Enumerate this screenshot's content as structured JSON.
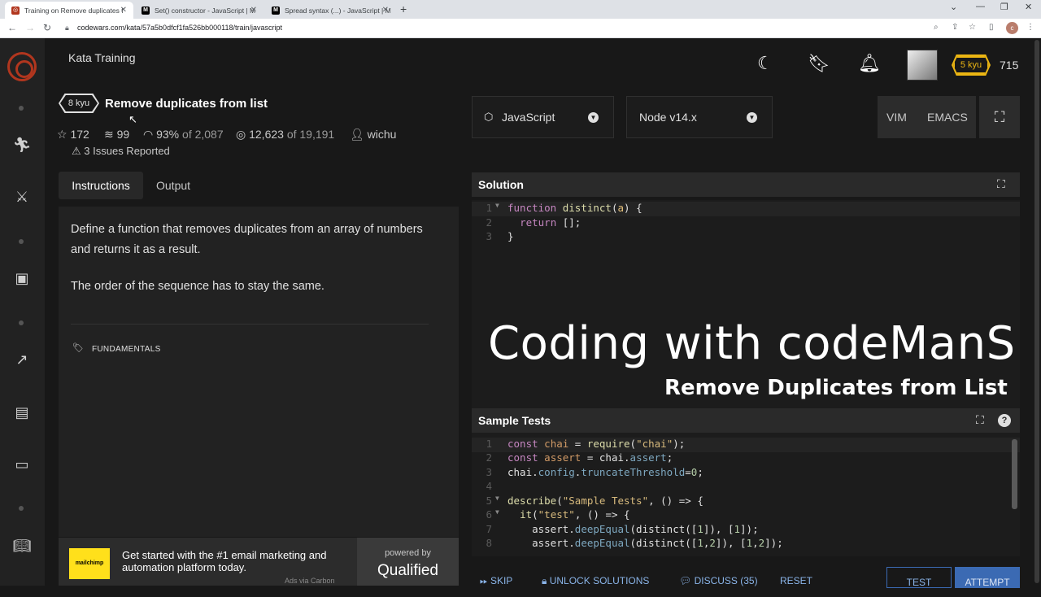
{
  "browser": {
    "tabs": [
      {
        "title": "Training on Remove duplicates f",
        "favicon_color": "#b1361e"
      },
      {
        "title": "Set() constructor - JavaScript | M",
        "favicon_color": "#000000"
      },
      {
        "title": "Spread syntax (...) - JavaScript | M",
        "favicon_color": "#000000"
      }
    ],
    "new_tab": "+",
    "url": "codewars.com/kata/57a5b0dfcf1fa526bb000118/train/javascript"
  },
  "app": {
    "header_title": "Kata Training",
    "rank": "5 kyu",
    "honor": "715"
  },
  "kata": {
    "kyu": "8 kyu",
    "title": "Remove duplicates from list",
    "stars": "172",
    "collections": "99",
    "satisfaction": "93%",
    "satisfaction_of": "of 2,087",
    "completed": "12,623",
    "completed_of": "of 19,191",
    "author": "wichu",
    "issues": "3 Issues Reported"
  },
  "tabs": {
    "instructions": "Instructions",
    "output": "Output"
  },
  "description": {
    "p1": "Define a function that removes duplicates from an array of numbers and returns it as a result.",
    "p2": "The order of the sequence has to stay the same.",
    "tag": "FUNDAMENTALS"
  },
  "ad": {
    "logo": "mailchimp",
    "text": "Get started with the #1 email marketing and automation platform today.",
    "via": "Ads via Carbon",
    "powered_by": "powered by",
    "brand": "Qualified"
  },
  "editor_options": {
    "language": "JavaScript",
    "version": "Node v14.x",
    "vim": "VIM",
    "emacs": "EMACS"
  },
  "solution": {
    "title": "Solution",
    "lines": [
      "1",
      "2",
      "3"
    ]
  },
  "sample_tests": {
    "title": "Sample Tests",
    "lines": [
      "1",
      "2",
      "3",
      "4",
      "5",
      "6",
      "7",
      "8"
    ]
  },
  "watermark": {
    "line1": "Coding with codeManS",
    "line2": "Remove Duplicates from List"
  },
  "actions": {
    "skip": "SKIP",
    "unlock": "UNLOCK SOLUTIONS",
    "discuss": "DISCUSS (35)",
    "reset": "RESET",
    "test": "TEST",
    "attempt": "ATTEMPT"
  },
  "colors": {
    "background": "#181818",
    "accent_red": "#b1361e",
    "rank_yellow": "#ecb613",
    "button_blue": "#3b6ab3"
  }
}
